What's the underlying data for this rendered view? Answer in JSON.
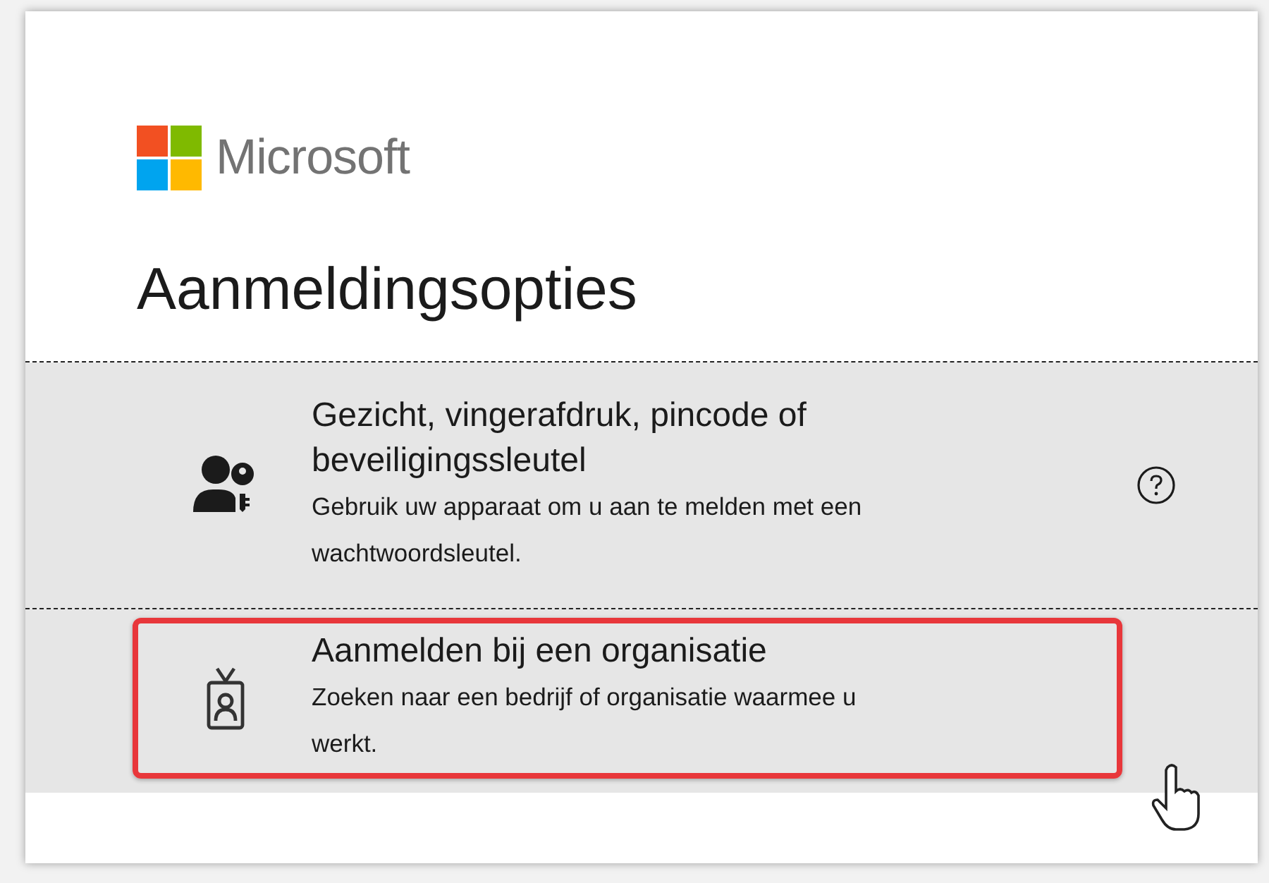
{
  "brand": {
    "name": "Microsoft"
  },
  "title": "Aanmeldingsopties",
  "options": [
    {
      "kind": "key",
      "title": "Gezicht, vingerafdruk, pincode of beveiligingssleutel",
      "description": "Gebruik uw apparaat om u aan te melden met een wachtwoordsleutel.",
      "help": true,
      "highlighted": false
    },
    {
      "kind": "badge",
      "title": "Aanmelden bij een organisatie",
      "description": "Zoeken naar een bedrijf of organisatie waarmee u werkt.",
      "help": false,
      "highlighted": true
    }
  ]
}
